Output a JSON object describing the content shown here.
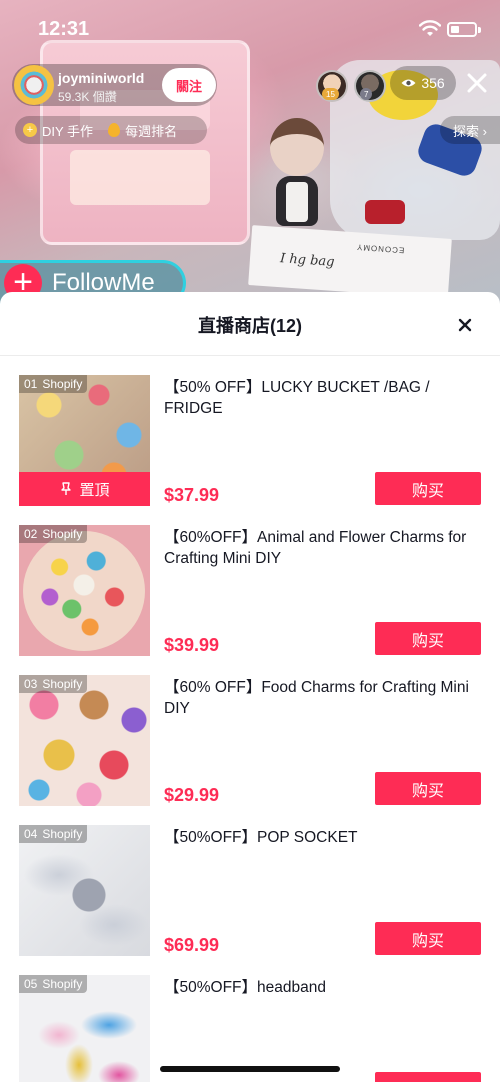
{
  "status_bar": {
    "time": "12:31"
  },
  "live": {
    "host": {
      "name": "joyminiworld",
      "followers": "59.3K 個讚",
      "follow_label": "關注"
    },
    "viewers": [
      {
        "badge": "15"
      },
      {
        "badge": "7"
      }
    ],
    "viewer_count": "356",
    "tags": {
      "category": "DIY 手作",
      "ranking": "每週排名"
    },
    "explore_label": "探索 ›",
    "followme_label": "FollowMe",
    "scene_text": {
      "handwriting": "I hg bag",
      "box_print": "ECONOMY"
    }
  },
  "shop": {
    "title": "直播商店(12)",
    "source_label": "Shopify",
    "pin_label": "置頂",
    "buy_label": "购买",
    "products": [
      {
        "rank": "01",
        "title": "【50% OFF】LUCKY BUCKET /BAG / FRIDGE",
        "price": "$37.99"
      },
      {
        "rank": "02",
        "title": "【60%OFF】Animal and Flower Charms for Crafting Mini DIY",
        "price": "$39.99"
      },
      {
        "rank": "03",
        "title": "【60% OFF】Food Charms for Crafting Mini DIY",
        "price": "$29.99"
      },
      {
        "rank": "04",
        "title": "【50%OFF】POP SOCKET",
        "price": "$69.99"
      },
      {
        "rank": "05",
        "title": "【50%OFF】headband",
        "price": ""
      }
    ]
  },
  "colors": {
    "accent": "#fe2c55",
    "followme_border": "#2fd0e0"
  }
}
